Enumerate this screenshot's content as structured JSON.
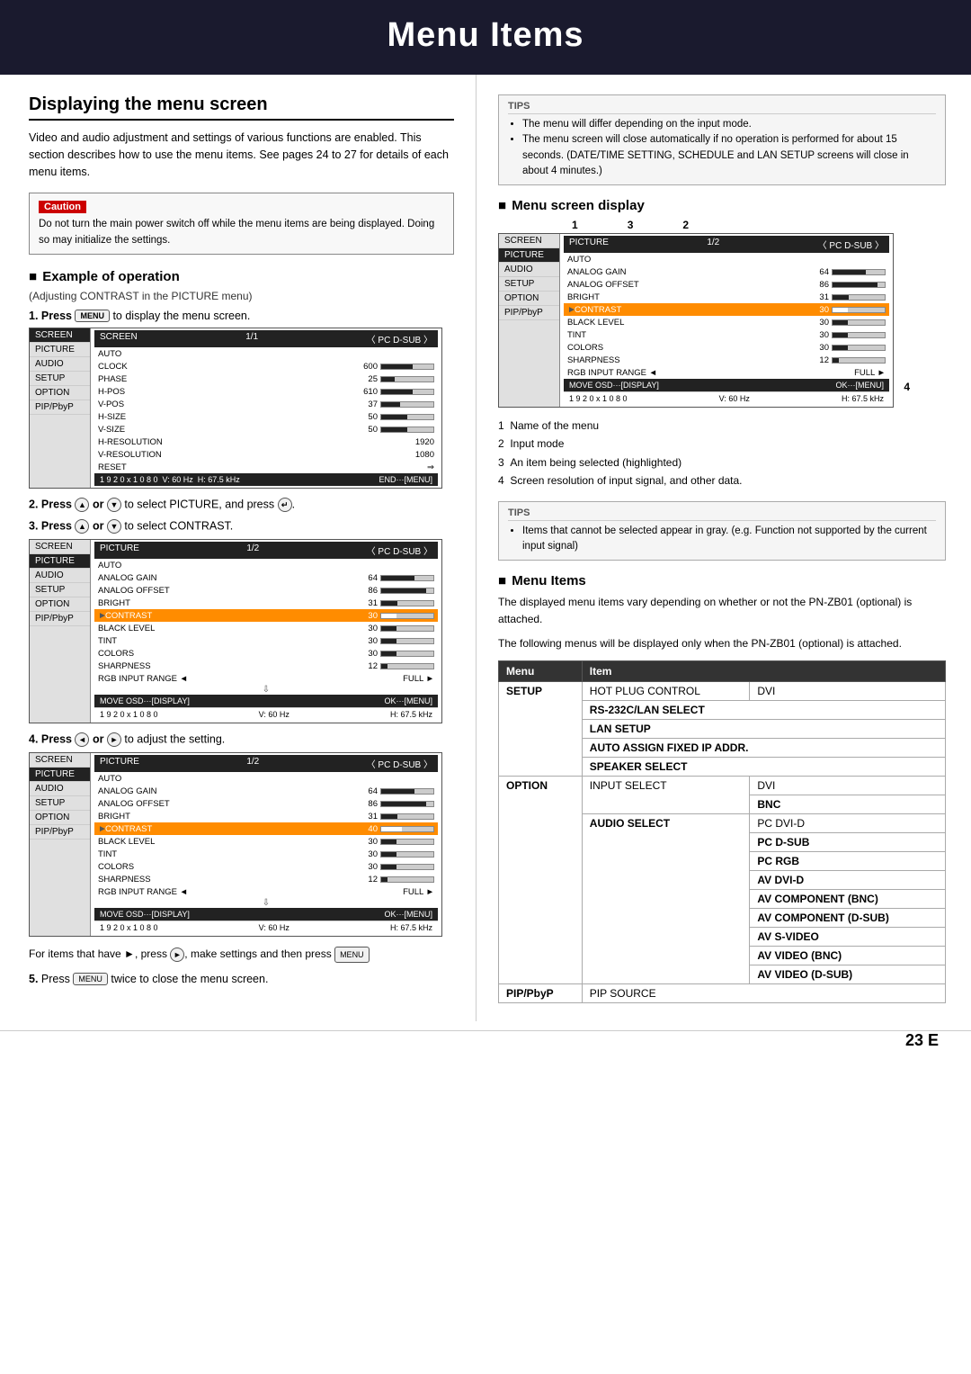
{
  "header": {
    "title": "Menu Items"
  },
  "left": {
    "section_title": "Displaying the menu screen",
    "intro": "Video and audio adjustment and settings of various functions are enabled. This section describes how to use the menu items. See pages 24 to 27 for details of each menu items.",
    "caution": {
      "label": "Caution",
      "text": "Do not turn the main power switch off while the menu items are being displayed. Doing so may initialize the settings."
    },
    "example_heading": "Example of operation",
    "adjusting_note": "(Adjusting CONTRAST in the PICTURE menu)",
    "step1": {
      "number": "1.",
      "text": "Press",
      "button": "MENU",
      "suffix": "to display the menu screen."
    },
    "step2": {
      "number": "2.",
      "text": "Press",
      "button1": "▲",
      "or": "or",
      "button2": "▼",
      "suffix": "to select PICTURE, and press"
    },
    "step3": {
      "number": "3.",
      "text": "Press",
      "button1": "▲",
      "or": "or",
      "button2": "▼",
      "suffix": "to select CONTRAST."
    },
    "step4": {
      "number": "4.",
      "text": "Press",
      "button1": "◄",
      "or": "or",
      "button2": "►",
      "suffix": "to adjust the setting."
    },
    "for_items_text": "For items that have ►, press ▶, make settings and then press MENU",
    "step5": {
      "number": "5.",
      "text": "Press",
      "button": "MENU",
      "suffix": "twice to close the menu screen."
    },
    "osd1": {
      "menu_items": [
        "SCREEN",
        "PICTURE",
        "AUDIO",
        "SETUP",
        "OPTION",
        "PIP/PbyP"
      ],
      "active_menu": "SCREEN",
      "header_left": "SCREEN",
      "header_center": "1/1",
      "header_right": "〈 PC D-SUB 〉",
      "rows": [
        {
          "label": "AUTO",
          "val": "",
          "bar": false
        },
        {
          "label": "CLOCK",
          "val": "600",
          "bar": true,
          "fill": 0.6
        },
        {
          "label": "PHASE",
          "val": "25",
          "bar": true,
          "fill": 0.25
        },
        {
          "label": "H-POS",
          "val": "610",
          "bar": true,
          "fill": 0.61
        },
        {
          "label": "V-POS",
          "val": "37",
          "bar": true,
          "fill": 0.37
        },
        {
          "label": "H-SIZE",
          "val": "50",
          "bar": true,
          "fill": 0.5
        },
        {
          "label": "V-SIZE",
          "val": "50",
          "bar": true,
          "fill": 0.5
        },
        {
          "label": "H-RESOLUTION",
          "val": "1920",
          "bar": false
        },
        {
          "label": "V-RESOLUTION",
          "val": "1080",
          "bar": false
        },
        {
          "label": "RESET",
          "val": "⇒",
          "bar": false
        }
      ],
      "footer_left": "1 9 2 0 x 1 0 8 0",
      "footer_center": "V: 60 Hz",
      "footer_right": "H: 67.5 kHz",
      "footer_end": "END···[MENU]"
    },
    "osd2": {
      "menu_items": [
        "SCREEN",
        "PICTURE",
        "AUDIO",
        "SETUP",
        "OPTION",
        "PIP/PbyP"
      ],
      "active_menu": "PICTURE",
      "header_left": "PICTURE",
      "header_center": "1/2",
      "header_right": "〈 PC D-SUB 〉",
      "rows": [
        {
          "label": "AUTO",
          "val": "",
          "bar": false,
          "highlighted": false
        },
        {
          "label": "ANALOG GAIN",
          "val": "64",
          "bar": true,
          "fill": 0.64,
          "highlighted": false
        },
        {
          "label": "ANALOG OFFSET",
          "val": "86",
          "bar": true,
          "fill": 0.86,
          "highlighted": false
        },
        {
          "label": "BRIGHT",
          "val": "31",
          "bar": true,
          "fill": 0.31,
          "highlighted": false
        },
        {
          "label": "CONTRAST",
          "val": "30",
          "bar": true,
          "fill": 0.3,
          "highlighted": true
        },
        {
          "label": "BLACK LEVEL",
          "val": "30",
          "bar": true,
          "fill": 0.3,
          "highlighted": false
        },
        {
          "label": "TINT",
          "val": "30",
          "bar": true,
          "fill": 0.3,
          "highlighted": false
        },
        {
          "label": "COLORS",
          "val": "30",
          "bar": true,
          "fill": 0.3,
          "highlighted": false
        },
        {
          "label": "SHARPNESS",
          "val": "12",
          "bar": true,
          "fill": 0.12,
          "highlighted": false
        },
        {
          "label": "RGB INPUT RANGE ◄",
          "val": "",
          "bar": false,
          "right_text": "FULL ►",
          "highlighted": false
        }
      ],
      "footer_left": "MOVE OSD···[DISPLAY]",
      "footer_center": "",
      "footer_right": "OK···[MENU]",
      "sub_footer_left": "1 9 2 0 x 1 0 8 0",
      "sub_footer_center": "V: 60 Hz",
      "sub_footer_right": "H: 67.5 kHz"
    },
    "osd3": {
      "menu_items": [
        "SCREEN",
        "PICTURE",
        "AUDIO",
        "SETUP",
        "OPTION",
        "PIP/PbyP"
      ],
      "active_menu": "PICTURE",
      "header_left": "PICTURE",
      "header_center": "1/2",
      "header_right": "〈 PC D-SUB 〉",
      "rows": [
        {
          "label": "AUTO",
          "val": "",
          "bar": false,
          "highlighted": false
        },
        {
          "label": "ANALOG GAIN",
          "val": "64",
          "bar": true,
          "fill": 0.64,
          "highlighted": false
        },
        {
          "label": "ANALOG OFFSET",
          "val": "86",
          "bar": true,
          "fill": 0.86,
          "highlighted": false
        },
        {
          "label": "BRIGHT",
          "val": "31",
          "bar": true,
          "fill": 0.31,
          "highlighted": false
        },
        {
          "label": "CONTRAST",
          "val": "40",
          "bar": true,
          "fill": 0.4,
          "highlighted": true
        },
        {
          "label": "BLACK LEVEL",
          "val": "30",
          "bar": true,
          "fill": 0.3,
          "highlighted": false
        },
        {
          "label": "TINT",
          "val": "30",
          "bar": true,
          "fill": 0.3,
          "highlighted": false
        },
        {
          "label": "COLORS",
          "val": "30",
          "bar": true,
          "fill": 0.3,
          "highlighted": false
        },
        {
          "label": "SHARPNESS",
          "val": "12",
          "bar": true,
          "fill": 0.12,
          "highlighted": false
        },
        {
          "label": "RGB INPUT RANGE ◄",
          "val": "",
          "bar": false,
          "right_text": "FULL ►",
          "highlighted": false
        }
      ],
      "footer_left": "MOVE OSD···[DISPLAY]",
      "footer_center": "",
      "footer_right": "OK···[MENU]",
      "sub_footer_left": "1 9 2 0 x 1 0 8 0",
      "sub_footer_center": "V: 60 Hz",
      "sub_footer_right": "H: 67.5 kHz"
    }
  },
  "right": {
    "tips1": {
      "label": "TIPS",
      "items": [
        "The menu will differ depending on the input mode.",
        "The menu screen will close automatically if no operation is performed for about 15 seconds. (DATE/TIME SETTING, SCHEDULE and LAN SETUP screens will close in about 4 minutes.)"
      ]
    },
    "menu_screen_heading": "Menu screen display",
    "numbered_labels": [
      "1",
      "3",
      "2"
    ],
    "osd_right": {
      "menu_items": [
        "SCREEN",
        "PICTURE",
        "AUDIO",
        "SETUP",
        "OPTION",
        "PIP/PbyP"
      ],
      "active_menu": "PICTURE",
      "header_left": "PICTURE",
      "header_center": "1/2",
      "header_right": "〈 PC D-SUB 〉",
      "rows": [
        {
          "label": "AUTO",
          "val": "",
          "bar": false,
          "highlighted": false
        },
        {
          "label": "ANALOG GAIN",
          "val": "64",
          "bar": true,
          "fill": 0.64,
          "highlighted": false
        },
        {
          "label": "ANALOG OFFSET",
          "val": "86",
          "bar": true,
          "fill": 0.86,
          "highlighted": false
        },
        {
          "label": "BRIGHT",
          "val": "31",
          "bar": true,
          "fill": 0.31,
          "highlighted": false
        },
        {
          "label": "CONTRAST",
          "val": "30",
          "bar": true,
          "fill": 0.3,
          "highlighted": true
        },
        {
          "label": "BLACK LEVEL",
          "val": "30",
          "bar": true,
          "fill": 0.3,
          "highlighted": false
        },
        {
          "label": "TINT",
          "val": "30",
          "bar": true,
          "fill": 0.3,
          "highlighted": false
        },
        {
          "label": "COLORS",
          "val": "30",
          "bar": true,
          "fill": 0.3,
          "highlighted": false
        },
        {
          "label": "SHARPNESS",
          "val": "12",
          "bar": true,
          "fill": 0.12,
          "highlighted": false
        },
        {
          "label": "RGB INPUT RANGE ◄",
          "val": "",
          "bar": false,
          "right_text": "FULL ►",
          "highlighted": false
        }
      ],
      "footer_left": "MOVE OSD···[DISPLAY]",
      "footer_right": "OK···[MENU]",
      "sub_footer_left": "1 9 2 0 x 1 0 8 0",
      "sub_footer_center": "V: 60 Hz",
      "sub_footer_right": "H: 67.5 kHz",
      "marker": "4"
    },
    "legend": [
      "1  Name of the menu",
      "2  Input mode",
      "3  An item being selected (highlighted)",
      "4  Screen resolution of input signal, and other data."
    ],
    "tips2": {
      "label": "TIPS",
      "items": [
        "Items that cannot be selected appear in gray. (e.g. Function not supported by the current input signal)"
      ]
    },
    "menu_items_heading": "Menu Items",
    "menu_items_desc1": "The displayed menu items vary depending on whether or not the PN-ZB01 (optional) is attached.",
    "menu_items_desc2": "The following menus will be displayed only when the PN-ZB01 (optional) is attached.",
    "table": {
      "headers": [
        "Menu",
        "Item"
      ],
      "rows": [
        {
          "menu": "SETUP",
          "item1": "HOT PLUG CONTROL",
          "item2": "DVI",
          "rowspan": true
        },
        {
          "menu": "",
          "item1": "RS-232C/LAN SELECT",
          "item2": ""
        },
        {
          "menu": "",
          "item1": "LAN SETUP",
          "item2": ""
        },
        {
          "menu": "",
          "item1": "AUTO ASSIGN FIXED IP ADDR.",
          "item2": ""
        },
        {
          "menu": "",
          "item1": "SPEAKER SELECT",
          "item2": ""
        },
        {
          "menu": "OPTION",
          "item1": "INPUT SELECT",
          "item2": "DVI"
        },
        {
          "menu": "",
          "item1": "",
          "item2": "BNC"
        },
        {
          "menu": "",
          "item1": "AUDIO SELECT",
          "item2": "PC DVI-D"
        },
        {
          "menu": "",
          "item1": "",
          "item2": "PC D-SUB"
        },
        {
          "menu": "",
          "item1": "",
          "item2": "PC RGB"
        },
        {
          "menu": "",
          "item1": "",
          "item2": "AV DVI-D"
        },
        {
          "menu": "",
          "item1": "",
          "item2": "AV COMPONENT (BNC)"
        },
        {
          "menu": "",
          "item1": "",
          "item2": "AV COMPONENT (D-SUB)"
        },
        {
          "menu": "",
          "item1": "",
          "item2": "AV S-VIDEO"
        },
        {
          "menu": "",
          "item1": "",
          "item2": "AV VIDEO (BNC)"
        },
        {
          "menu": "",
          "item1": "",
          "item2": "AV VIDEO (D-SUB)"
        },
        {
          "menu": "PIP/PbyP",
          "item1": "PIP SOURCE",
          "item2": ""
        }
      ]
    }
  },
  "footer": {
    "page_number": "23 E"
  }
}
